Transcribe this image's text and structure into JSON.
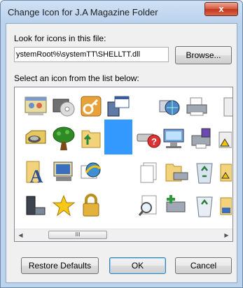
{
  "window": {
    "title": "Change Icon for J.A Magazine Folder",
    "close_label": "x"
  },
  "file_section": {
    "label": "Look for icons in this file:",
    "path_value": "ystemRoot%\\systemTT\\SHELLTT.dll",
    "browse_label": "Browse..."
  },
  "list_section": {
    "label": "Select an icon from the list below:",
    "icons": [
      {
        "name": "window-settings-icon"
      },
      {
        "name": "cd-drive-icon"
      },
      {
        "name": "key-icon"
      },
      {
        "name": "computer-window-icon"
      },
      {
        "name": "network-globe-icon"
      },
      {
        "name": "printer-icon"
      },
      {
        "name": "drive-icon"
      },
      {
        "name": "tree-icon"
      },
      {
        "name": "folder-up-icon"
      },
      {
        "name": "selected-icon"
      },
      {
        "name": "drive-help-icon"
      },
      {
        "name": "network-computer-icon"
      },
      {
        "name": "fax-printer-icon"
      },
      {
        "name": "font-icon"
      },
      {
        "name": "monitor-icon"
      },
      {
        "name": "internet-icon"
      },
      {
        "name": "documents-icon"
      },
      {
        "name": "print-folder-icon"
      },
      {
        "name": "recycle-bin-full-icon"
      },
      {
        "name": "computer-tower-icon"
      },
      {
        "name": "star-icon"
      },
      {
        "name": "padlock-icon"
      },
      {
        "name": "search-doc-icon"
      },
      {
        "name": "network-add-icon"
      },
      {
        "name": "recycle-bin-empty-icon"
      }
    ],
    "scroll_thumb_label": "III"
  },
  "footer": {
    "restore_label": "Restore Defaults",
    "ok_label": "OK",
    "cancel_label": "Cancel"
  },
  "colors": {
    "titlebar": "#bcd3ee",
    "close_button": "#c2371c",
    "selection": "#3399ff"
  }
}
